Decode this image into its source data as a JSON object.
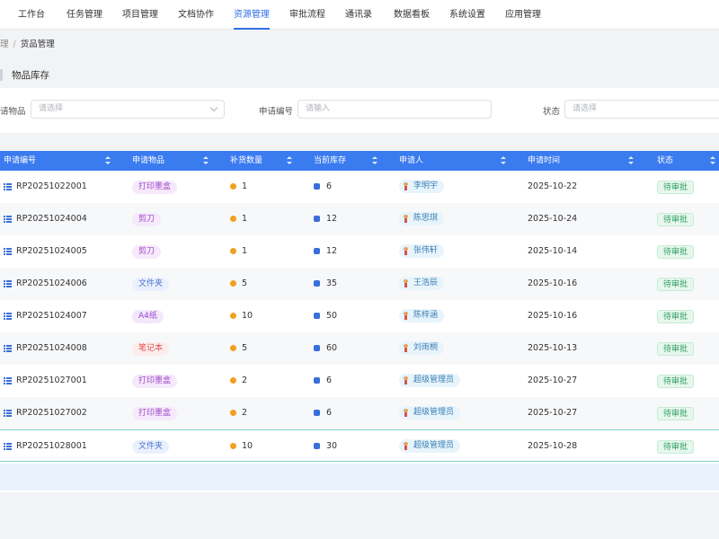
{
  "nav": {
    "items": [
      {
        "label": "工作台"
      },
      {
        "label": "任务管理"
      },
      {
        "label": "项目管理"
      },
      {
        "label": "文档协作"
      },
      {
        "label": "资源管理",
        "active": true
      },
      {
        "label": "审批流程"
      },
      {
        "label": "通讯录"
      },
      {
        "label": "数据看板"
      },
      {
        "label": "系统设置"
      },
      {
        "label": "应用管理"
      }
    ],
    "accent": "#2f6fe8"
  },
  "breadcrumb": {
    "parent": "理",
    "separator": "/",
    "current": "货品管理"
  },
  "section": {
    "title": "物品库存"
  },
  "filters": {
    "item_label": "请物品",
    "item_placeholder": "请选择",
    "code_label": "申请编号",
    "code_placeholder": "请输入",
    "status_label": "状态",
    "status_placeholder": "请选择"
  },
  "table": {
    "headers": [
      "申请编号",
      "申请物品",
      "补货数量",
      "当前库存",
      "申请人",
      "申请时间",
      "状态"
    ],
    "header_color": "#3b7bf0",
    "rows": [
      {
        "code": "RP20251022001",
        "item": "打印墨盒",
        "qty": "1",
        "stock": "6",
        "applicant": "李明宇",
        "date": "2025-10-22",
        "status": "待审批"
      },
      {
        "code": "RP20251024004",
        "item": "剪刀",
        "qty": "1",
        "stock": "12",
        "applicant": "陈思琪",
        "date": "2025-10-24",
        "status": "待审批"
      },
      {
        "code": "RP20251024005",
        "item": "剪刀",
        "qty": "1",
        "stock": "12",
        "applicant": "张伟轩",
        "date": "2025-10-14",
        "status": "待审批"
      },
      {
        "code": "RP20251024006",
        "item": "文件夹",
        "qty": "5",
        "stock": "35",
        "applicant": "王浩辰",
        "date": "2025-10-16",
        "status": "待审批"
      },
      {
        "code": "RP20251024007",
        "item": "A4纸",
        "qty": "10",
        "stock": "50",
        "applicant": "陈梓涵",
        "date": "2025-10-16",
        "status": "待审批"
      },
      {
        "code": "RP20251024008",
        "item": "笔记本",
        "qty": "5",
        "stock": "60",
        "applicant": "刘雨桐",
        "date": "2025-10-13",
        "status": "待审批"
      },
      {
        "code": "RP20251027001",
        "item": "打印墨盒",
        "qty": "2",
        "stock": "6",
        "applicant": "超级管理员",
        "date": "2025-10-27",
        "status": "待审批"
      },
      {
        "code": "RP20251027002",
        "item": "打印墨盒",
        "qty": "2",
        "stock": "6",
        "applicant": "超级管理员",
        "date": "2025-10-27",
        "status": "待审批"
      },
      {
        "code": "RP20251028001",
        "item": "文件夹",
        "qty": "10",
        "stock": "30",
        "applicant": "超级管理员",
        "date": "2025-10-28",
        "status": "待审批"
      }
    ],
    "item_tag_colors": {
      "打印墨盒": {
        "bg": "#f5e9fb",
        "fg": "#a048c8"
      },
      "剪刀": {
        "bg": "#f5e9fb",
        "fg": "#a048c8"
      },
      "文件夹": {
        "bg": "#eaf0fd",
        "fg": "#4a73c9"
      },
      "A4纸": {
        "bg": "#f3e8fb",
        "fg": "#9a45d0"
      },
      "笔记本": {
        "bg": "#fdecec",
        "fg": "#d9534f"
      }
    }
  }
}
